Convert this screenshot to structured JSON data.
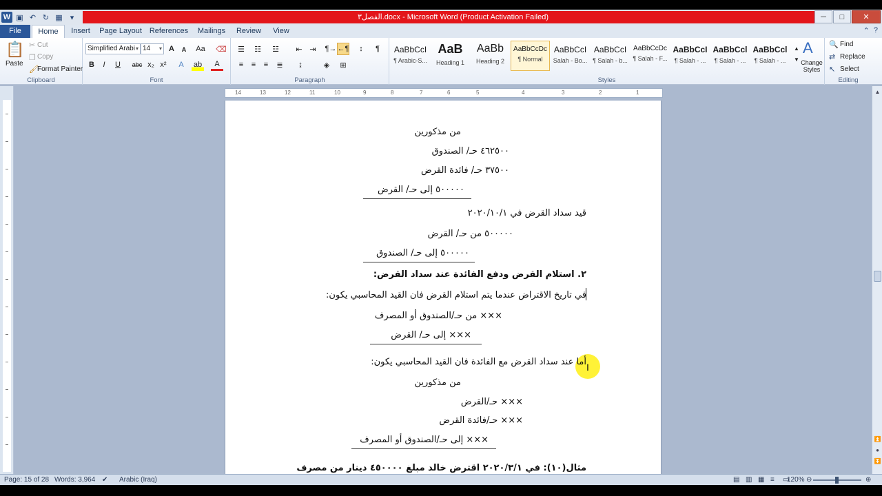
{
  "window": {
    "title": "الفصل٣.docx  -  Microsoft Word (Product Activation Failed)",
    "minimize": "─",
    "maximize": "□",
    "close": "✕"
  },
  "tabs": [
    "File",
    "Home",
    "Insert",
    "Page Layout",
    "References",
    "Mailings",
    "Review",
    "View"
  ],
  "clipboard": {
    "paste": "Paste",
    "cut": "Cut",
    "copy": "Copy",
    "format_painter": "Format Painter",
    "label": "Clipboard"
  },
  "font": {
    "name": "Simplified Arabi",
    "size": "14",
    "label": "Font"
  },
  "paragraph": {
    "label": "Paragraph"
  },
  "styles": {
    "label": "Styles",
    "items": [
      {
        "sample": "AaBbCcI",
        "name": "¶ Arabic-S..."
      },
      {
        "sample": "AaB",
        "name": "Heading 1"
      },
      {
        "sample": "AaBb",
        "name": "Heading 2"
      },
      {
        "sample": "AaBbCcDc",
        "name": "¶ Normal"
      },
      {
        "sample": "AaBbCcI",
        "name": "Salah - Bo..."
      },
      {
        "sample": "AaBbCcI",
        "name": "¶ Salah - b..."
      },
      {
        "sample": "AaBbCcDc",
        "name": "¶ Salah - F..."
      },
      {
        "sample": "AaBbCcI",
        "name": "¶ Salah - ..."
      },
      {
        "sample": "AaBbCcl",
        "name": "¶ Salah - ..."
      },
      {
        "sample": "AaBbCcl",
        "name": "¶ Salah - ..."
      }
    ],
    "change_styles": "Change Styles"
  },
  "editing": {
    "find": "Find",
    "replace": "Replace",
    "select": "Select",
    "label": "Editing"
  },
  "ruler_numbers": [
    "14",
    "13",
    "12",
    "11",
    "10",
    "9",
    "8",
    "7",
    "6",
    "5",
    "4",
    "3",
    "2",
    "1"
  ],
  "document": {
    "lines": [
      "من مذكورين",
      "٤٦٢٥٠٠   حـ/  الصندوق",
      "٣٧٥٠٠   حـ/ فائدة  القرض",
      "٥٠٠٠٠٠   إلى حـ/ القرض",
      "قيد سداد القرض في  ٢٠٢٠/١٠/١",
      "٥٠٠٠٠٠   من حـ/   القرض",
      "٥٠٠٠٠٠   إلى حـ/ الصندوق",
      "٢.  استلام القرض ودفع الفائدة عند سداد القرض:",
      "في تاريخ الاقتراض عندما يتم  استلام القرض فان القيد المحاسبي يكون:",
      "××× من حـ/الصندوق أو المصرف",
      "××× إلى حـ/ القرض",
      "أما عند سداد القرض مع الفائدة فان القيد المحاسبي يكون:",
      "من مذكورين",
      "××× حـ/القرض",
      "××× حـ/فائدة  القرض",
      "××× إلى حـ/الصندوق أو المصرف",
      "مثال(١٠): في ٢٠٢٠/٣/١ اقترض خالد مبلغ ٤٥٠٠٠٠ دينار  من مصرف"
    ]
  },
  "status": {
    "page": "Page: 15 of 28",
    "words": "Words: 3,964",
    "language": "Arabic (Iraq)",
    "zoom": "120%"
  }
}
